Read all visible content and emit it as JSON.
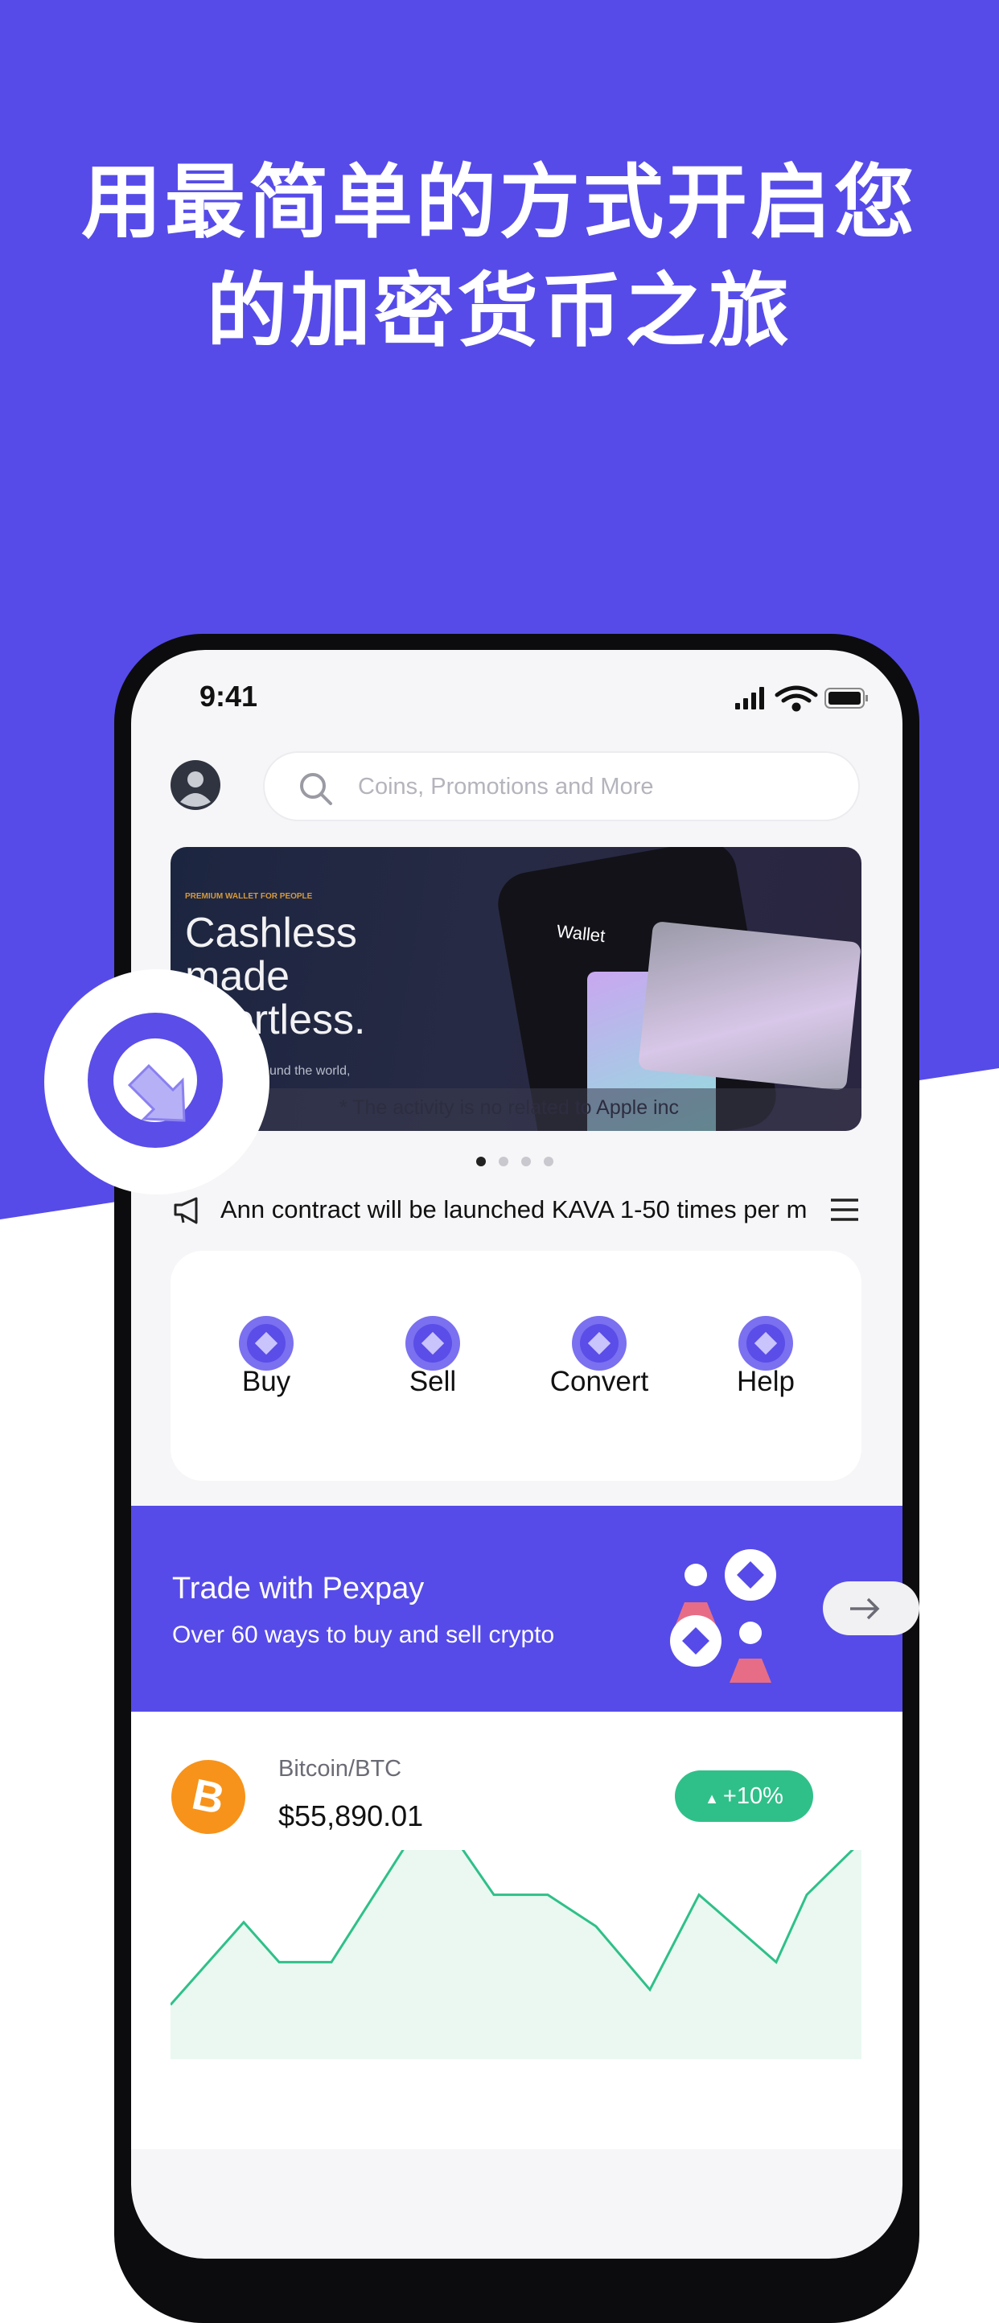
{
  "promo": {
    "headline_line1": "用最简单的方式开启您",
    "headline_line2": "的加密货币之旅"
  },
  "colors": {
    "brand": "#564be8",
    "positive": "#2fc089",
    "bitcoin": "#f7931a"
  },
  "status_bar": {
    "time": "9:41",
    "icons": [
      "signal-icon",
      "wifi-icon",
      "battery-icon"
    ]
  },
  "header": {
    "avatar": "user-avatar-icon",
    "search_placeholder": "Coins, Promotions and More"
  },
  "banner": {
    "eyebrow": "PREMIUM WALLET FOR PEOPLE",
    "title_line1": "Cashless",
    "title_line2": "made",
    "title_line3": "effortless.",
    "body": "companies around the world,",
    "phone_label": "Wallet",
    "disclaimer": "* The activity is no related to Apple inc",
    "pages": 4,
    "active_page": 0
  },
  "announcement": {
    "text": "Ann contract will be launched KAVA 1-50 times per m",
    "icon": "megaphone-icon",
    "menu_icon": "menu-icon"
  },
  "actions": [
    {
      "label": "Buy",
      "icon": "buy-icon"
    },
    {
      "label": "Sell",
      "icon": "sell-icon"
    },
    {
      "label": "Convert",
      "icon": "convert-icon"
    },
    {
      "label": "Help",
      "icon": "help-icon"
    }
  ],
  "trade": {
    "title": "Trade with Pexpay",
    "subtitle": "Over 60 ways to buy and sell crypto",
    "arrow_icon": "arrow-right-icon"
  },
  "market": {
    "pair": "Bitcoin/BTC",
    "price": "$55,890.01",
    "change": "+10%",
    "sparkline": [
      22,
      82,
      53,
      53,
      141,
      141,
      102,
      102,
      79,
      33,
      102,
      53,
      102,
      141
    ]
  }
}
